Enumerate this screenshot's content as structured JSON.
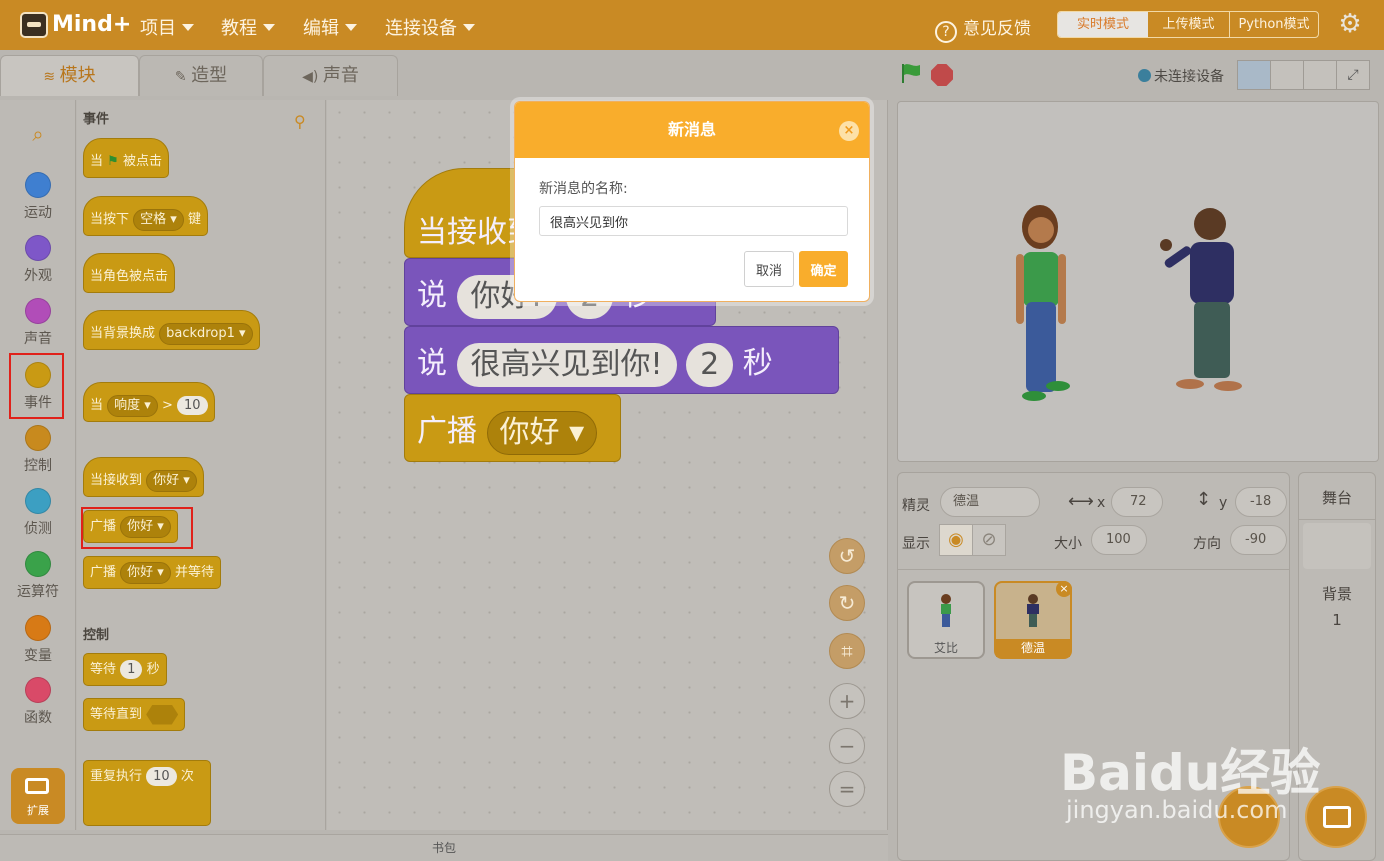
{
  "app": {
    "logo": "Mind+"
  },
  "menu": [
    {
      "label": "项目"
    },
    {
      "label": "教程"
    },
    {
      "label": "编辑"
    },
    {
      "label": "连接设备"
    }
  ],
  "header": {
    "feedback": "意见反馈",
    "modes": [
      "实时模式",
      "上传模式",
      "Python模式"
    ]
  },
  "tabs": [
    "模块",
    "造型",
    "声音"
  ],
  "device": {
    "status": "未连接设备"
  },
  "categories": [
    {
      "label": "运动",
      "color": "#3f7fd0"
    },
    {
      "label": "外观",
      "color": "#7e57c8"
    },
    {
      "label": "声音",
      "color": "#b14db8"
    },
    {
      "label": "事件",
      "color": "#c99a14"
    },
    {
      "label": "控制",
      "color": "#c88a1e"
    },
    {
      "label": "侦测",
      "color": "#3c9fc2"
    },
    {
      "label": "运算符",
      "color": "#3aa24a"
    },
    {
      "label": "变量",
      "color": "#d77a16"
    },
    {
      "label": "函数",
      "color": "#d94a68"
    }
  ],
  "extension": {
    "label": "扩展"
  },
  "palette": {
    "events_title": "事件",
    "flag_clicked": {
      "pre": "当",
      "post": "被点击"
    },
    "key_pressed": {
      "pre": "当按下",
      "key": "空格",
      "post": "键"
    },
    "sprite_clicked": "当角色被点击",
    "backdrop_switch": {
      "pre": "当背景换成",
      "value": "backdrop1"
    },
    "loudness": {
      "pre": "当",
      "param": "响度",
      "op": ">",
      "value": "10"
    },
    "receive": {
      "pre": "当接收到",
      "msg": "你好"
    },
    "broadcast": {
      "pre": "广播",
      "msg": "你好"
    },
    "broadcast_wait": {
      "pre": "广播",
      "msg": "你好",
      "post": "并等待"
    },
    "control_title": "控制",
    "wait": {
      "pre": "等待",
      "value": "1",
      "post": "秒"
    },
    "wait_until": {
      "pre": "等待直到"
    },
    "repeat": {
      "pre": "重复执行",
      "value": "10",
      "post": "次"
    }
  },
  "workspace": {
    "hat": "当接收到",
    "say1": {
      "verb": "说",
      "text": "你好!",
      "secs": "2",
      "unit": "秒"
    },
    "say2": {
      "verb": "说",
      "text": "很高兴见到你!",
      "secs": "2",
      "unit": "秒"
    },
    "broadcast": {
      "verb": "广播",
      "msg": "你好"
    },
    "backpack": "书包"
  },
  "sprite_info": {
    "sprite_label": "精灵",
    "sprite_name": "德温",
    "x_label": "x",
    "x": "72",
    "y_label": "y",
    "y": "-18",
    "show_label": "显示",
    "size_label": "大小",
    "size": "100",
    "direction_label": "方向",
    "direction": "-90"
  },
  "sprites": [
    {
      "name": "艾比"
    },
    {
      "name": "德温"
    }
  ],
  "stage_panel": {
    "title": "舞台",
    "backdrop_label": "背景",
    "backdrop_count": "1"
  },
  "dialog": {
    "title": "新消息",
    "prompt": "新消息的名称:",
    "value": "很高兴见到你",
    "cancel": "取消",
    "ok": "确定"
  },
  "watermark": {
    "brand": "Baidu经验",
    "url": "jingyan.baidu.com"
  }
}
